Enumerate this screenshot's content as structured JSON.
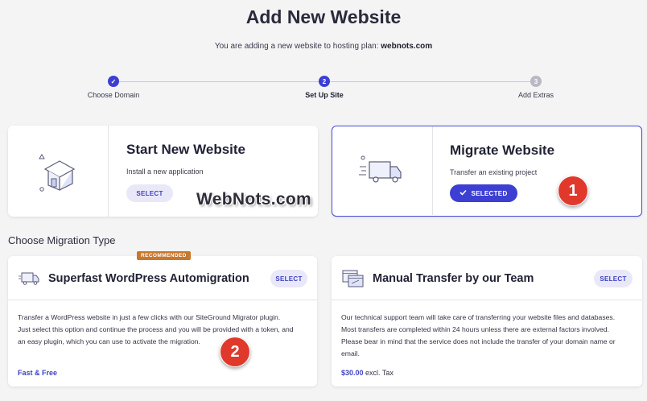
{
  "header": {
    "title": "Add New Website",
    "subtitle_prefix": "You are adding a new website to hosting plan:",
    "plan_name": "webnots.com"
  },
  "stepper": {
    "steps": [
      {
        "number": "1",
        "label": "Choose Domain",
        "state": "done"
      },
      {
        "number": "2",
        "label": "Set Up Site",
        "state": "active"
      },
      {
        "number": "3",
        "label": "Add Extras",
        "state": "pending"
      }
    ],
    "check_glyph": "✓",
    "colors": {
      "active": "#3c3fd1",
      "pending": "#b9b9c2"
    }
  },
  "site_options": {
    "start_new": {
      "title": "Start New Website",
      "description": "Install a new application",
      "button_label": "SELECT",
      "icon": "house-icon"
    },
    "migrate": {
      "title": "Migrate Website",
      "description": "Transfer an existing project",
      "button_label": "SELECTED",
      "icon": "truck-icon",
      "selected": true
    }
  },
  "migration": {
    "section_title": "Choose Migration Type",
    "automigration": {
      "badge": "RECOMMENDED",
      "title": "Superfast WordPress Automigration",
      "button_label": "SELECT",
      "lines": [
        "Transfer a WordPress website in just a few clicks with our SiteGround Migrator plugin.",
        "Just select this option and continue the process and you will be provided with a token, and",
        "an easy plugin, which you can use to activate the migration."
      ],
      "footer": "Fast & Free",
      "icon": "truck-icon"
    },
    "manual": {
      "title": "Manual Transfer by our Team",
      "button_label": "SELECT",
      "lines": [
        "Our technical support team will take care of transferring your website files and databases.",
        "Most transfers are completed within 24 hours unless there are external factors involved.",
        "Please bear in mind that the service does not include the transfer of your domain name or",
        "email."
      ],
      "price": "$30.00",
      "price_suffix": "excl. Tax",
      "icon": "windows-icon"
    }
  },
  "annotations": {
    "watermark": "WebNots.com",
    "badge_1": "1",
    "badge_2": "2"
  },
  "colors": {
    "accent": "#3c3fd1",
    "accent_light": "#e9e8f8",
    "recommended": "#c8772e",
    "annotation_red": "#e0392b"
  }
}
